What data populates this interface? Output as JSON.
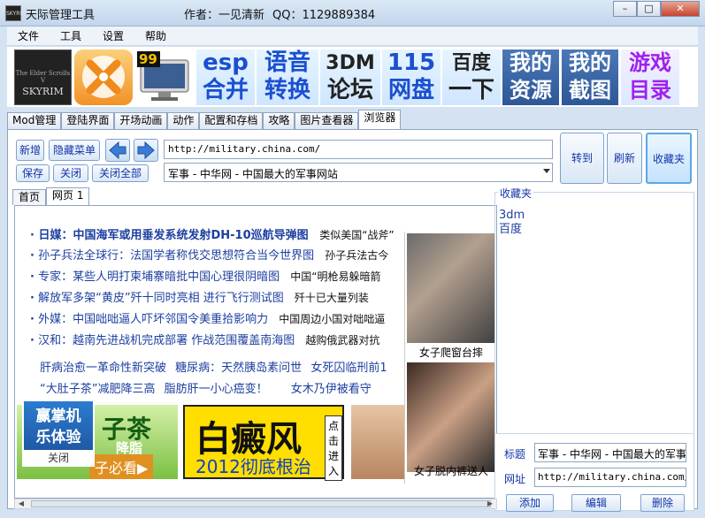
{
  "window": {
    "title": "天际管理工具",
    "author": "作者：一见清新",
    "qq": "QQ：1129889384",
    "minimize": "–",
    "maximize": "□",
    "close": "✕"
  },
  "menu": [
    "文件",
    "工具",
    "设置",
    "帮助"
  ],
  "banner": {
    "skyrim_sub": "The Elder Scrolls V",
    "skyrim": "SKYRIM",
    "monitor_badge": "99",
    "tiles": [
      {
        "l1": "esp",
        "l2": "合并"
      },
      {
        "l1": "语音",
        "l2": "转换"
      },
      {
        "l1": "3DM",
        "l2": "论坛"
      },
      {
        "l1": "115",
        "l2": "网盘"
      },
      {
        "l1": "百度",
        "l2": "一下"
      },
      {
        "l1": "我的",
        "l2": "资源"
      },
      {
        "l1": "我的",
        "l2": "截图"
      },
      {
        "l1": "游戏",
        "l2": "目录"
      }
    ]
  },
  "tabs": [
    "Mod管理",
    "登陆界面",
    "开场动画",
    "动作",
    "配置和存档",
    "攻略",
    "图片查看器",
    "浏览器"
  ],
  "toolbar": {
    "new": "新增",
    "hide_menu": "隐藏菜单",
    "save": "保存",
    "close": "关闭",
    "close_all": "关闭全部",
    "url": "http://military.china.com/",
    "page_title": "军事 - 中华网 - 中国最大的军事网站",
    "go": "转到",
    "refresh": "刷新",
    "favorites": "收藏夹"
  },
  "browser_tabs": [
    "首页",
    "网页 1"
  ],
  "news": [
    {
      "main": "日媒：中国海军或用垂发系统发射DH-10巡航导弹图",
      "side": "类似美国“战斧”"
    },
    {
      "main": "孙子兵法全球行：法国学者称伐交思想符合当今世界图",
      "side": "孙子兵法古今"
    },
    {
      "main": "专家：某些人明打柬埔寨暗批中国心理很阴暗图",
      "side": "中国“明枪易躲暗箭"
    },
    {
      "main": "解放军多架“黄皮”歼十同时亮相 进行飞行测试图",
      "side": "歼十已大量列装"
    },
    {
      "main": "外媒：中国咄咄逼人吓坏邻国令美重拾影响力",
      "side": "中国周边小国对咄咄逼"
    },
    {
      "main": "汉和：越南先进战机完成部署 作战范围覆盖南海图",
      "side": "越购俄武器对抗"
    }
  ],
  "health": [
    [
      "肝病治愈一革命性新突破",
      "糖尿病：天然胰岛素问世",
      "女死囚临刑前1"
    ],
    [
      "“大肚子茶”减肥降三高",
      "脂肪肝一小心癌变！",
      "女木乃伊被看守"
    ]
  ],
  "ads": {
    "game_l1": "赢掌机",
    "game_l2": "乐体验",
    "game_close": "关闭",
    "tea_big": "子茶",
    "tea_mid": "降脂",
    "tea_cta": "子必看▶",
    "vitiligo": "白癜风",
    "vitiligo_sub": "2012彻底根治",
    "vitiligo_side": "点击进入"
  },
  "pics": [
    "女子爬窗台摔",
    "女子脱内裤送人"
  ],
  "favorites": {
    "legend": "收藏夹",
    "items": [
      "3dm",
      "百度"
    ],
    "title_label": "标题",
    "title_value": "军事 - 中华网 - 中国最大的军事",
    "url_label": "网址",
    "url_value": "http://military.china.com/",
    "add": "添加",
    "edit": "编辑",
    "delete": "删除"
  },
  "colors": {
    "accent": "#1335a8",
    "link": "#1c3fa0",
    "frame": "#d4e2f2",
    "close": "#c64430"
  }
}
